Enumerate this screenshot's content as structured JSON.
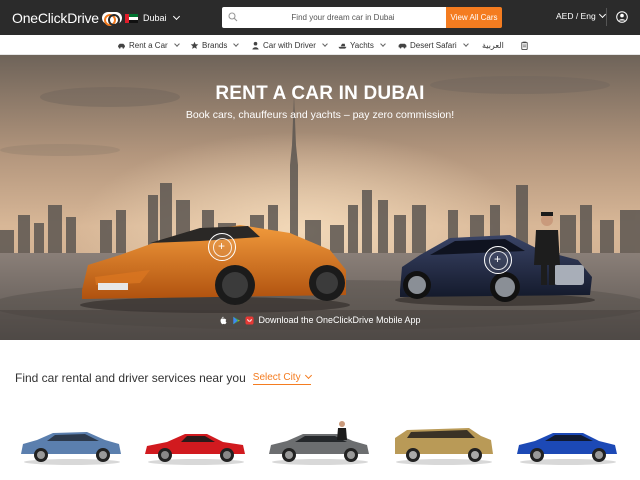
{
  "header": {
    "logo_text": "OneClickDrive",
    "city": "Dubai",
    "search": {
      "placeholder": "Find your dream car in Dubai"
    },
    "view_all_label": "View All Cars",
    "currency_lang": "AED / Eng"
  },
  "nav": {
    "items": [
      {
        "label": "Rent a Car",
        "icon": "car-icon",
        "has_dropdown": true
      },
      {
        "label": "Brands",
        "icon": "star-icon",
        "has_dropdown": true
      },
      {
        "label": "Car with Driver",
        "icon": "chauffeur-icon",
        "has_dropdown": true
      },
      {
        "label": "Yachts",
        "icon": "yacht-icon",
        "has_dropdown": true
      },
      {
        "label": "Desert Safari",
        "icon": "suv-icon",
        "has_dropdown": true
      },
      {
        "label": "العربية",
        "icon": "",
        "has_dropdown": false
      },
      {
        "label": "",
        "icon": "clipboard-icon",
        "has_dropdown": false
      }
    ]
  },
  "hero": {
    "title": "RENT A CAR IN DUBAI",
    "subtitle": "Book cars, chauffeurs and yachts – pay zero commission!",
    "hotspot_symbol": "+",
    "app_cta": "Download the OneClickDrive Mobile App",
    "app_icons": [
      "apple-icon",
      "google-play-icon",
      "huawei-appgallery-icon"
    ]
  },
  "find": {
    "text": "Find car rental and driver services near you",
    "select_label": "Select City"
  },
  "cars": {
    "items": [
      {
        "color": "#5b7fae"
      },
      {
        "color": "#d11a1f"
      },
      {
        "color": "#6c6e70"
      },
      {
        "color": "#b99a57"
      },
      {
        "color": "#1c49b6"
      }
    ]
  },
  "colors": {
    "accent": "#f47c20",
    "header_bg": "#2b2b2b"
  }
}
